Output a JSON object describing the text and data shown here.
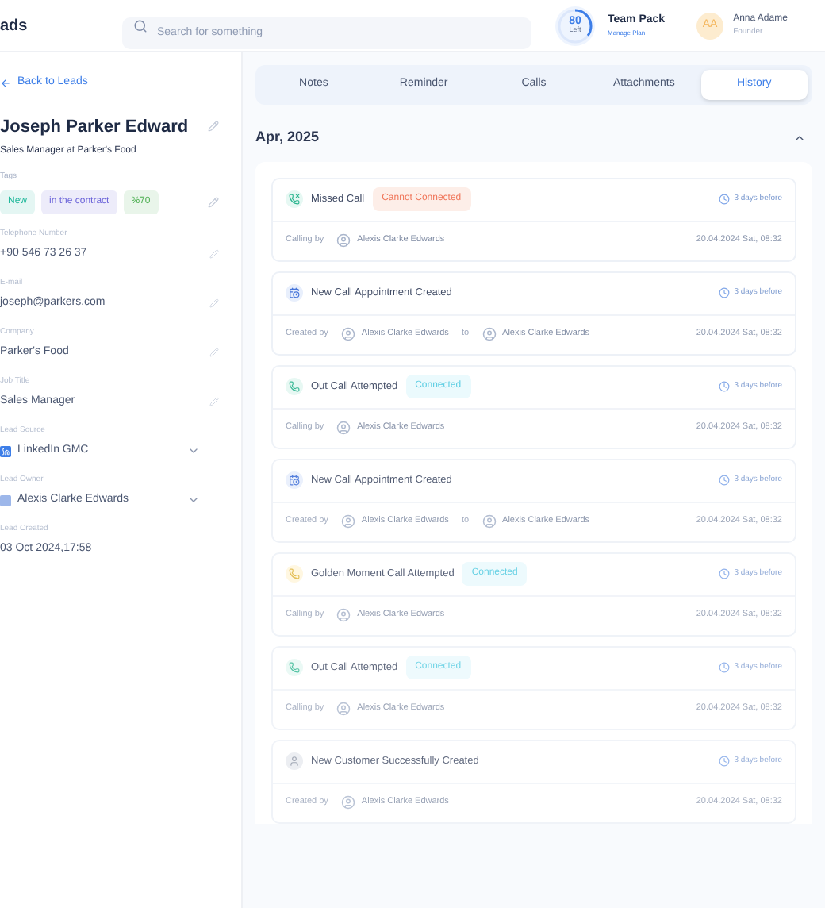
{
  "header": {
    "title": "ads",
    "search": {
      "placeholder": "Search for something"
    },
    "plan": {
      "count": "80",
      "count_label": "Left",
      "level": 0.35,
      "name": "Team Pack",
      "link": "Manage Plan"
    },
    "user": {
      "initials": "AA",
      "name": "Anna Adame",
      "role": "Founder"
    }
  },
  "sidebar": {
    "back_link": "Back to Leads",
    "name": "Joseph Parker Edward",
    "subtitle": "Sales Manager at Parker's Food",
    "tags_label": "Tags",
    "tags": [
      {
        "label": "New",
        "color": "#1fb89a"
      },
      {
        "label": "in the contract",
        "color": "#6b63d9"
      },
      {
        "label": "%70",
        "color": "#4caf50"
      }
    ],
    "fields": [
      {
        "label": "Telephone Number",
        "value": "+90 546 73 26 37",
        "kind": "edit"
      },
      {
        "label": "E-mail",
        "value": "joseph@parkers.com",
        "kind": "edit"
      },
      {
        "label": "Company",
        "value": "Parker's Food",
        "kind": "edit"
      },
      {
        "label": "Job Title",
        "value": "Sales Manager",
        "kind": "edit"
      },
      {
        "label": "Lead Source",
        "value": "LinkedIn GMC",
        "kind": "linkedin"
      },
      {
        "label": "Lead Owner",
        "value": "Alexis Clarke Edwards",
        "kind": "owner"
      },
      {
        "label": "Lead Created",
        "value": "03 Oct 2024,17:58",
        "kind": "plain"
      }
    ]
  },
  "tabs": [
    {
      "label": "Notes",
      "selected": false
    },
    {
      "label": "Reminder",
      "selected": false
    },
    {
      "label": "Calls",
      "selected": false
    },
    {
      "label": "Attachments",
      "selected": false
    },
    {
      "label": "History",
      "selected": true
    }
  ],
  "history": {
    "month": "Apr, 2025",
    "expanded": true,
    "events": [
      {
        "kind": "missed",
        "title": "Missed Call",
        "badge": {
          "label": "Cannot Connected",
          "kind": "danger"
        },
        "time": "3 days before",
        "by_label": "Calling by",
        "person": "Alexis Clarke Edwards",
        "date": "20.04.2024 Sat, 08:32"
      },
      {
        "kind": "appointment",
        "title": "New Call Appointment Created",
        "time": "3 days before",
        "by_label": "Created by",
        "person": "Alexis Clarke Edwards",
        "to_label": "to",
        "to_person": "Alexis Clarke Edwards",
        "date": "20.04.2024 Sat, 08:32"
      },
      {
        "kind": "call",
        "title": "Out Call Attempted",
        "badge": {
          "label": "Connected",
          "kind": "success"
        },
        "time": "3 days before",
        "by_label": "Calling by",
        "person": "Alexis Clarke Edwards",
        "date": "20.04.2024 Sat, 08:32"
      },
      {
        "kind": "appointment",
        "title": "New Call Appointment Created",
        "time": "3 days before",
        "by_label": "Created by",
        "person": "Alexis Clarke Edwards",
        "to_label": "to",
        "to_person": "Alexis Clarke Edwards",
        "date": "20.04.2024 Sat, 08:32"
      },
      {
        "kind": "golden",
        "title": "Golden Moment Call Attempted",
        "badge": {
          "label": "Connected",
          "kind": "success"
        },
        "time": "3 days before",
        "by_label": "Calling by",
        "person": "Alexis Clarke Edwards",
        "date": "20.04.2024 Sat, 08:32"
      },
      {
        "kind": "call",
        "title": "Out Call Attempted",
        "badge": {
          "label": "Connected",
          "kind": "success"
        },
        "time": "3 days before",
        "by_label": "Calling by",
        "person": "Alexis Clarke Edwards",
        "date": "20.04.2024 Sat, 08:32"
      },
      {
        "kind": "customer",
        "title": "New Customer Successfully Created",
        "time": "3 days before",
        "by_label": "Created by",
        "person": "Alexis Clarke Edwards",
        "date": "20.04.2024 Sat, 08:32"
      }
    ]
  }
}
